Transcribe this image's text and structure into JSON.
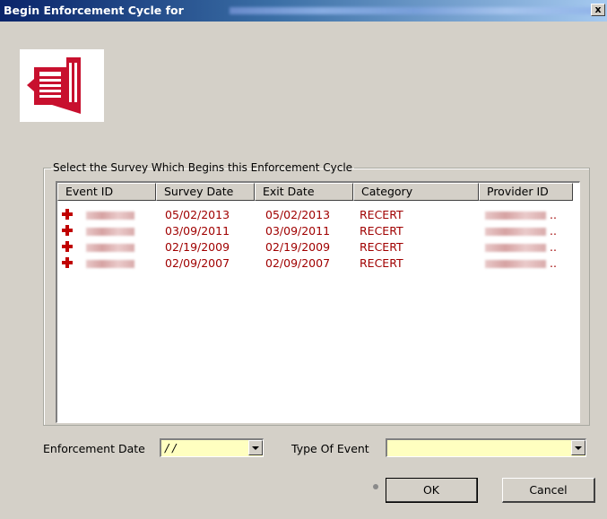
{
  "window": {
    "title": "Begin Enforcement Cycle for",
    "close_label": "x"
  },
  "survey_group": {
    "legend": "Select the Survey Which Begins this Enforcement Cycle",
    "columns": [
      "Event ID",
      "Survey Date",
      "Exit Date",
      "Category",
      "Provider ID"
    ],
    "rows": [
      {
        "survey_date": "05/02/2013",
        "exit_date": "05/02/2013",
        "category": "RECERT",
        "provider_suffix": ".."
      },
      {
        "survey_date": "03/09/2011",
        "exit_date": "03/09/2011",
        "category": "RECERT",
        "provider_suffix": ".."
      },
      {
        "survey_date": "02/19/2009",
        "exit_date": "02/19/2009",
        "category": "RECERT",
        "provider_suffix": ".."
      },
      {
        "survey_date": "02/09/2007",
        "exit_date": "02/09/2007",
        "category": "RECERT",
        "provider_suffix": ".."
      }
    ]
  },
  "form": {
    "enforcement_date_label": "Enforcement Date",
    "enforcement_date_value": "/ /",
    "type_of_event_label": "Type Of Event",
    "type_of_event_value": ""
  },
  "buttons": {
    "ok": "OK",
    "cancel": "Cancel"
  },
  "colors": {
    "title_bar": "#0a246a",
    "row_text": "#a00000",
    "input_bg": "#ffffc0",
    "logo_red": "#c8102e"
  },
  "icons": {
    "logo": "newspaper-arrow-icon",
    "row_marker": "red-plus-icon"
  }
}
